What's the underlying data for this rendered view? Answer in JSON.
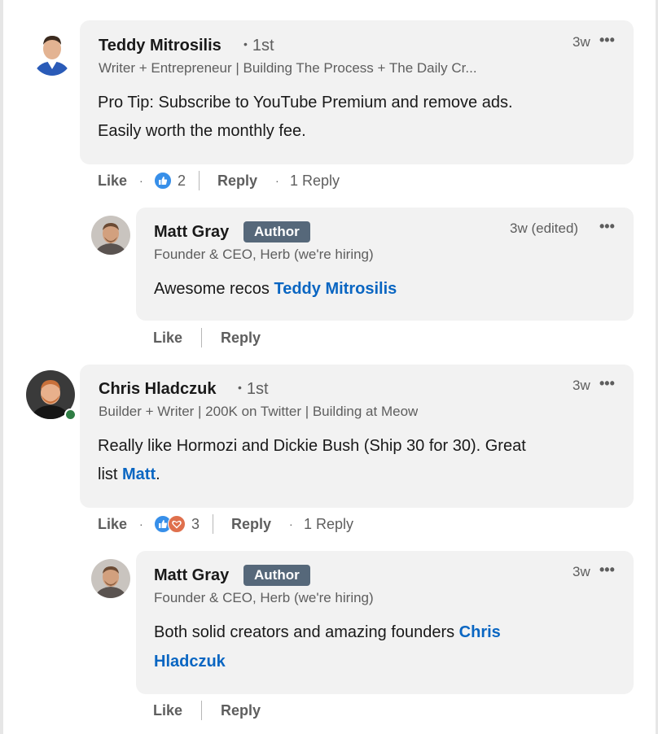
{
  "comments": [
    {
      "name": "Teddy Mitrosilis",
      "degree": "1st",
      "headline": "Writer + Entrepreneur | Building The Process + The Daily Cr...",
      "time": "3w",
      "body_line1": "Pro Tip: Subscribe to YouTube Premium and remove ads.",
      "body_line2": "Easily worth the monthly fee.",
      "like_label": "Like",
      "reaction_count": "2",
      "reply_label": "Reply",
      "replies_label": "1 Reply",
      "reply": {
        "name": "Matt Gray",
        "badge": "Author",
        "headline": "Founder & CEO, Herb (we're hiring)",
        "time": "3w (edited)",
        "body_prefix": "Awesome recos ",
        "mention": "Teddy Mitrosilis",
        "like_label": "Like",
        "reply_label": "Reply"
      }
    },
    {
      "name": "Chris Hladczuk",
      "degree": "1st",
      "headline": "Builder + Writer | 200K on Twitter | Building at Meow",
      "time": "3w",
      "body_line1": "Really like Hormozi and Dickie Bush (Ship 30 for 30). Great",
      "body_line2_prefix": "list ",
      "mention": "Matt",
      "body_line2_suffix": ".",
      "like_label": "Like",
      "reaction_count": "3",
      "reply_label": "Reply",
      "replies_label": "1 Reply",
      "reply": {
        "name": "Matt Gray",
        "badge": "Author",
        "headline": "Founder & CEO, Herb (we're hiring)",
        "time": "3w",
        "body_prefix": "Both solid creators and amazing founders ",
        "mention_line1": "Chris",
        "mention_line2": "Hladczuk",
        "like_label": "Like",
        "reply_label": "Reply"
      }
    }
  ],
  "colors": {
    "bubble": "#f2f2f2",
    "mention": "#0a66c2",
    "badge": "#56687a",
    "online": "#2f7d44",
    "like_reaction": "#378fe9",
    "love_reaction": "#df704d"
  },
  "icons": {
    "more": "more-horizontal-icon",
    "like_reaction": "thumbs-up-reaction-icon",
    "love_reaction": "heart-reaction-icon"
  }
}
